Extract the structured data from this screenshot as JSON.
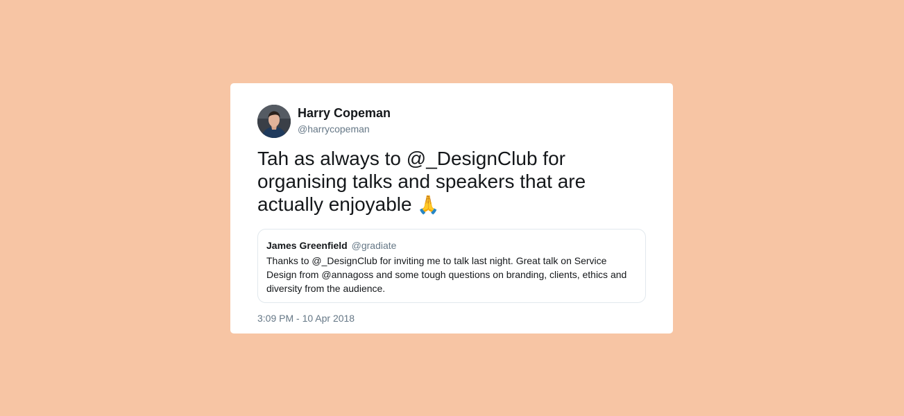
{
  "colors": {
    "background": "#F7C5A4",
    "card": "#FFFFFF",
    "primary_text": "#14171A",
    "secondary_text": "#657786",
    "quote_border": "#E1E8ED"
  },
  "tweet": {
    "author_name": "Harry Copeman",
    "author_handle": "@harrycopeman",
    "avatar_icon": "avatar-photo-icon",
    "text": "Tah as always to @_DesignClub for organising talks and speakers that are actually enjoyable",
    "emoji": "🙏",
    "timestamp": "3:09 PM - 10 Apr 2018"
  },
  "quoted_tweet": {
    "author_name": "James Greenfield",
    "author_handle": "@gradiate",
    "text": "Thanks to @_DesignClub for inviting me to talk last night. Great talk on Service Design from @annagoss and some tough questions on branding, clients, ethics and diversity from the audience."
  }
}
